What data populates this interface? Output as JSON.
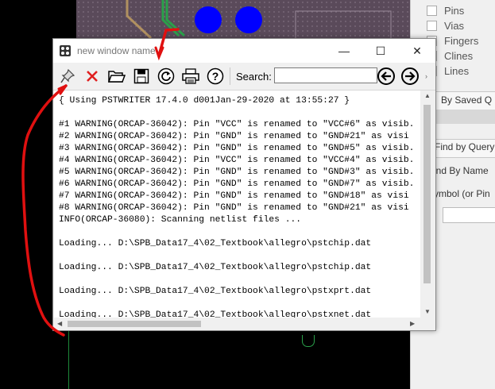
{
  "window": {
    "title": "new window name",
    "controls": {
      "minimize": "—",
      "maximize": "☐",
      "close": "✕"
    }
  },
  "toolbar": {
    "buttons": [
      {
        "name": "pin-icon",
        "icon": "pushpin"
      },
      {
        "name": "close-icon",
        "icon": "red-x",
        "color": "#e02020"
      },
      {
        "name": "open-folder-icon",
        "icon": "folder"
      },
      {
        "name": "save-icon",
        "icon": "floppy-disk"
      },
      {
        "name": "refresh-icon",
        "icon": "circular-arrow"
      },
      {
        "name": "print-icon",
        "icon": "printer"
      },
      {
        "name": "help-icon",
        "icon": "question-mark"
      }
    ],
    "search_label": "Search:",
    "search_value": "",
    "prev": "previous-arrow-icon",
    "next": "next-arrow-icon",
    "more": "›"
  },
  "log": {
    "lines": [
      "{ Using PSTWRITER 17.4.0 d001Jan-29-2020 at 13:55:27 }",
      "",
      "#1 WARNING(ORCAP-36042): Pin \"VCC\" is renamed to \"VCC#6\" as visib.",
      "#2 WARNING(ORCAP-36042): Pin \"GND\" is renamed to \"GND#21\" as visi",
      "#3 WARNING(ORCAP-36042): Pin \"GND\" is renamed to \"GND#5\" as visib.",
      "#4 WARNING(ORCAP-36042): Pin \"VCC\" is renamed to \"VCC#4\" as visib.",
      "#5 WARNING(ORCAP-36042): Pin \"GND\" is renamed to \"GND#3\" as visib.",
      "#6 WARNING(ORCAP-36042): Pin \"GND\" is renamed to \"GND#7\" as visib.",
      "#7 WARNING(ORCAP-36042): Pin \"GND\" is renamed to \"GND#18\" as visi",
      "#8 WARNING(ORCAP-36042): Pin \"GND\" is renamed to \"GND#21\" as visi",
      "INFO(ORCAP-36080): Scanning netlist files ...",
      "",
      "Loading... D:\\SPB_Data17_4\\02_Textbook\\allegro\\pstchip.dat",
      "",
      "Loading... D:\\SPB_Data17_4\\02_Textbook\\allegro\\pstchip.dat",
      "",
      "Loading... D:\\SPB_Data17_4\\02_Textbook\\allegro\\pstxprt.dat",
      "",
      "Loading... D:\\SPB_Data17_4\\02_Textbook\\allegro\\pstxnet.dat"
    ]
  },
  "panel": {
    "options": [
      "Pins",
      "Vias",
      "Fingers",
      "Clines",
      "Lines"
    ],
    "by_saved": "By Saved Q",
    "find_by_query": "Find by Query",
    "find_by_name": "ind By Name",
    "symbol": "ymbol (or Pin"
  },
  "colors": {
    "annotation": "#e01010",
    "pad": "#0000ff",
    "pcb": "#5a4a5a"
  }
}
